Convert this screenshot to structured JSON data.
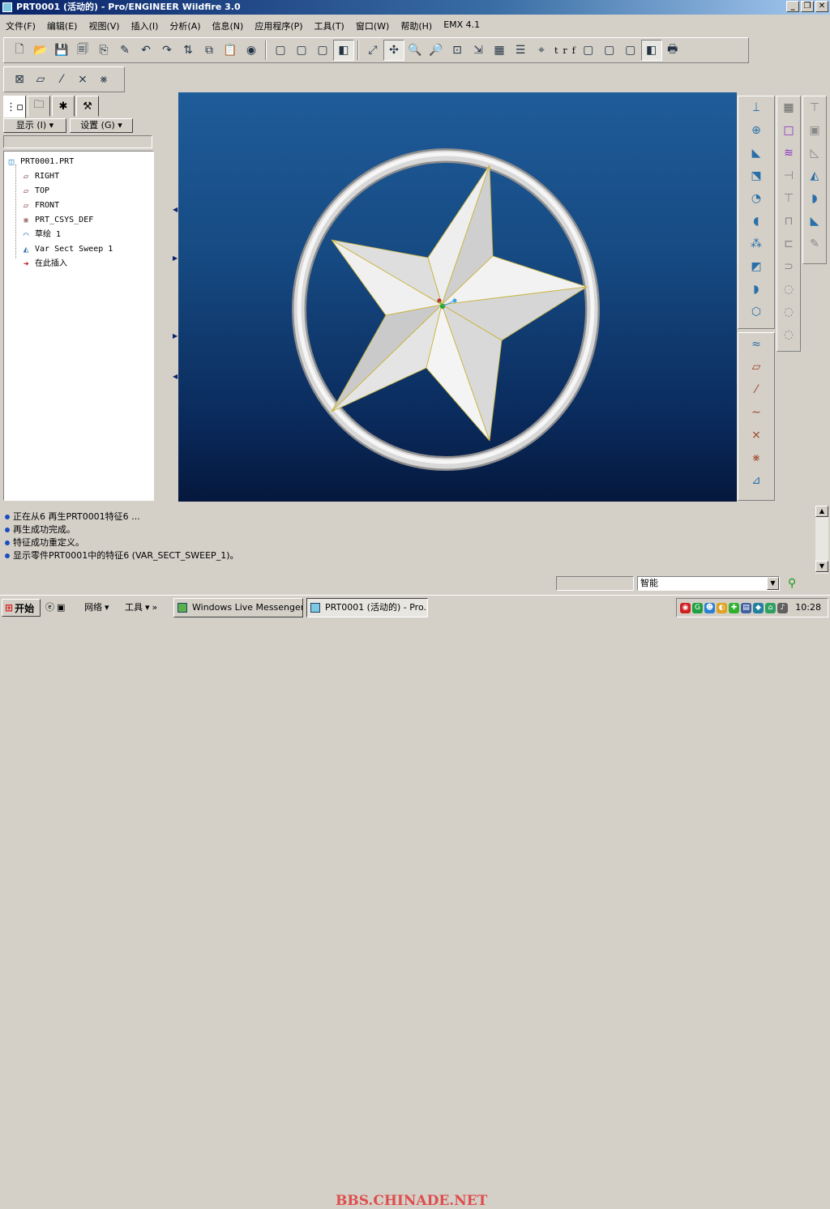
{
  "window": {
    "title": "PRT0001 (活动的) - Pro/ENGINEER Wildfire 3.0",
    "controls": [
      "_",
      "❐",
      "✕"
    ]
  },
  "menu": [
    "文件(F)",
    "编辑(E)",
    "视图(V)",
    "插入(I)",
    "分析(A)",
    "信息(N)",
    "应用程序(P)",
    "工具(T)",
    "窗口(W)",
    "帮助(H)",
    "EMX 4.1"
  ],
  "toolbar": {
    "datum_text_t": "t",
    "datum_text_r": "r",
    "datum_text_f": "f"
  },
  "model_tree": {
    "show_button": "显示 (I) ▾",
    "settings_button": "设置 (G) ▾",
    "items": [
      {
        "label": "PRT0001.PRT",
        "icon": "part-icon"
      },
      {
        "label": "RIGHT",
        "icon": "datum-plane-icon"
      },
      {
        "label": "TOP",
        "icon": "datum-plane-icon"
      },
      {
        "label": "FRONT",
        "icon": "datum-plane-icon"
      },
      {
        "label": "PRT_CSYS_DEF",
        "icon": "coordinate-system-icon"
      },
      {
        "label": "草绘 1",
        "icon": "sketch-icon"
      },
      {
        "label": "Var Sect Sweep 1",
        "icon": "sweep-icon"
      },
      {
        "label": "在此插入",
        "icon": "insert-here-arrow-icon"
      }
    ]
  },
  "messages": [
    "正在从6 再生PRT0001特征6 ...",
    "再生成功完成。",
    "特征成功重定义。",
    "显示零件PRT0001中的特征6 (VAR_SECT_SWEEP_1)。"
  ],
  "status": {
    "filter_value": "智能"
  },
  "taskbar": {
    "start": "开始",
    "network": "网络",
    "tools": "工具",
    "more": "»",
    "tasks": [
      {
        "label": "Windows Live Messenger..."
      },
      {
        "label": "PRT0001 (活动的) - Pro..."
      }
    ],
    "watermark": "BBS.CHINADE.NET",
    "clock": "10:28"
  },
  "colors": {
    "title_gradient_start": "#0a246a",
    "viewport_top": "#1f5c9a",
    "viewport_bottom": "#05183c",
    "model_surface": "#e6e6e6"
  }
}
